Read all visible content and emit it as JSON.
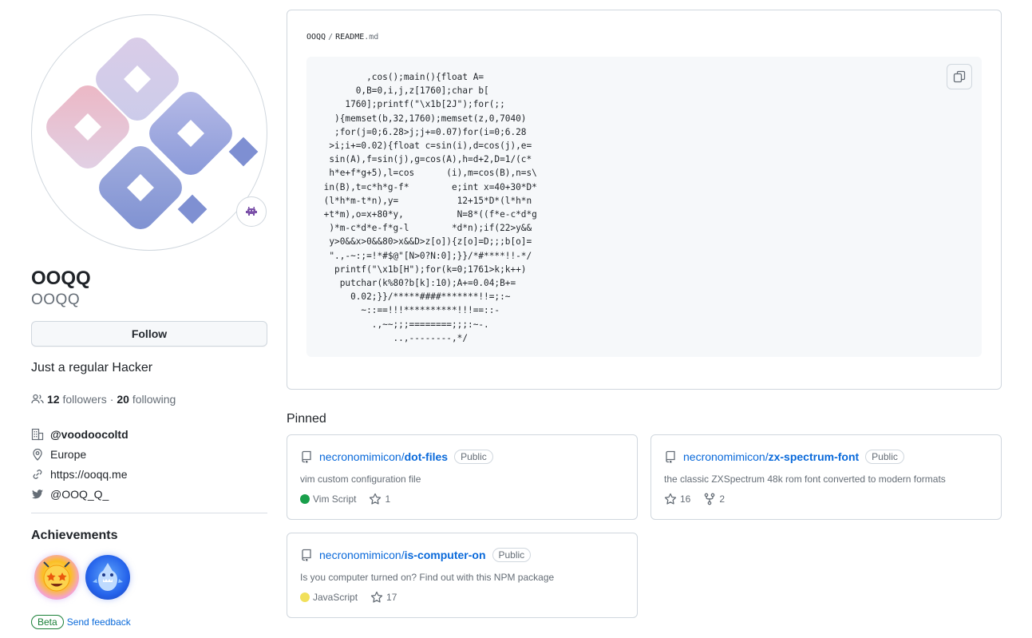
{
  "profile": {
    "full_name": "OOQQ",
    "username": "OOQQ",
    "follow_label": "Follow",
    "bio": "Just a regular Hacker",
    "followers_count": "12",
    "followers_label": "followers",
    "separator": "·",
    "following_count": "20",
    "following_label": "following",
    "status_icon": "alien-monster-icon",
    "details": {
      "company": "@voodoocoltd",
      "location": "Europe",
      "website": "https://ooqq.me",
      "twitter": "@OOQ_Q_"
    }
  },
  "achievements": {
    "title": "Achievements",
    "badges": [
      "starstruck-icon",
      "pull-shark-icon"
    ],
    "beta_label": "Beta",
    "feedback_label": "Send feedback"
  },
  "readme": {
    "owner": "OOQQ",
    "separator": "/",
    "file_base": "README",
    "file_ext": ".md",
    "copy_icon": "copy-icon",
    "code": "         ,cos();main(){float A=\n       0,B=0,i,j,z[1760];char b[\n     1760];printf(\"\\x1b[2J\");for(;;\n   ){memset(b,32,1760);memset(z,0,7040)\n   ;for(j=0;6.28>j;j+=0.07)for(i=0;6.28\n  >i;i+=0.02){float c=sin(i),d=cos(j),e=\n  sin(A),f=sin(j),g=cos(A),h=d+2,D=1/(c*\n  h*e+f*g+5),l=cos      (i),m=cos(B),n=s\\\n in(B),t=c*h*g-f*        e;int x=40+30*D*\n (l*h*m-t*n),y=           12+15*D*(l*h*n\n +t*m),o=x+80*y,          N=8*((f*e-c*d*g\n  )*m-c*d*e-f*g-l        *d*n);if(22>y&&\n  y>0&&x>0&&80>x&&D>z[o]){z[o]=D;;;b[o]=\n  \".,-~:;=!*#$@\"[N>0?N:0];}}/*#****!!-*/\n   printf(\"\\x1b[H\");for(k=0;1761>k;k++)\n    putchar(k%80?b[k]:10);A+=0.04;B+=\n      0.02;}}/*****####*******!!=;:~\n        ~::==!!!**********!!!==::-\n          .,~~;;;========;;;:~-.\n              ..,--------,*/"
  },
  "pinned": {
    "title": "Pinned",
    "repos": [
      {
        "owner": "necronomimicon",
        "name": "dot-files",
        "visibility": "Public",
        "description": "vim custom configuration file",
        "language": "Vim Script",
        "language_color": "#199f4b",
        "stars": "1",
        "forks": ""
      },
      {
        "owner": "necronomimicon",
        "name": "zx-spectrum-font",
        "visibility": "Public",
        "description": "the classic ZXSpectrum 48k rom font converted to modern formats",
        "language": "",
        "language_color": "",
        "stars": "16",
        "forks": "2"
      },
      {
        "owner": "necronomimicon",
        "name": "is-computer-on",
        "visibility": "Public",
        "description": "Is you computer turned on? Find out with this NPM package",
        "language": "JavaScript",
        "language_color": "#f1e05a",
        "stars": "17",
        "forks": ""
      }
    ]
  }
}
